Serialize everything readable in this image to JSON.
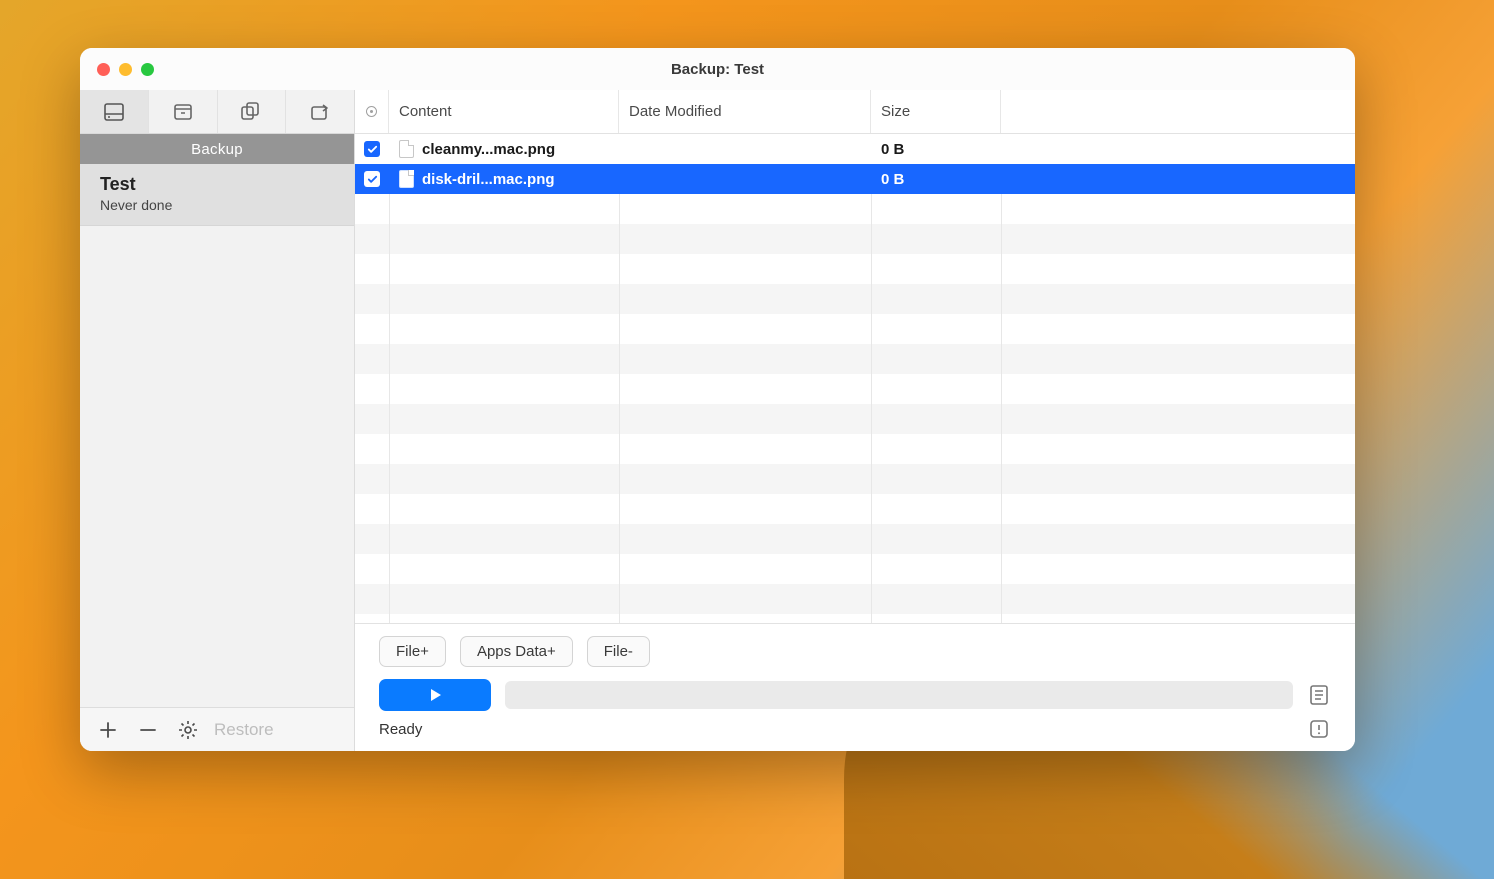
{
  "window": {
    "title": "Backup: Test"
  },
  "sidebar": {
    "header": "Backup",
    "items": [
      {
        "name": "Test",
        "subtitle": "Never done"
      }
    ],
    "footer": {
      "restore_label": "Restore"
    }
  },
  "columns": {
    "content": "Content",
    "date": "Date Modified",
    "size": "Size"
  },
  "rows": [
    {
      "checked": true,
      "name": "cleanmy...mac.png",
      "date": "",
      "size": "0 B",
      "selected": false
    },
    {
      "checked": true,
      "name": "disk-dril...mac.png",
      "date": "",
      "size": "0 B",
      "selected": true
    }
  ],
  "buttons": {
    "file_plus": "File+",
    "apps_data_plus": "Apps Data+",
    "file_minus": "File-"
  },
  "status": "Ready"
}
